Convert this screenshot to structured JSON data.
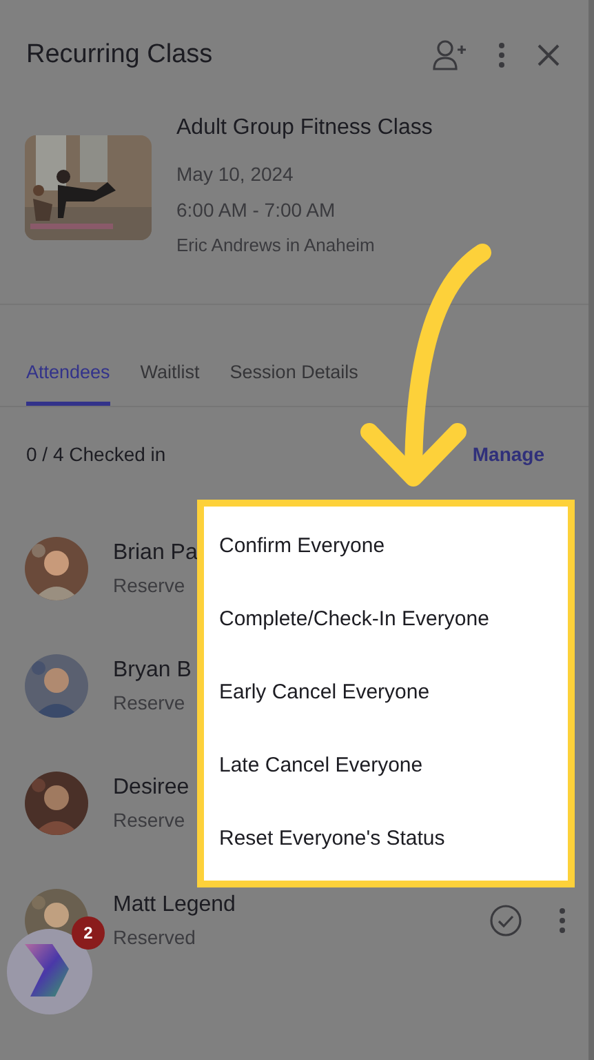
{
  "header": {
    "title": "Recurring Class"
  },
  "class_info": {
    "name": "Adult Group Fitness Class",
    "date": "May 10, 2024",
    "time": "6:00 AM - 7:00 AM",
    "instructor": "Eric Andrews in Anaheim"
  },
  "tabs": [
    {
      "label": "Attendees",
      "selected": true
    },
    {
      "label": "Waitlist",
      "selected": false
    },
    {
      "label": "Session Details",
      "selected": false
    }
  ],
  "check_in": {
    "summary": "0 / 4 Checked in",
    "action": "Manage"
  },
  "attendees": [
    {
      "name": "Brian Pa",
      "status": "Reserve"
    },
    {
      "name": "Bryan B",
      "status": "Reserve"
    },
    {
      "name": "Desiree",
      "status": "Reserve"
    },
    {
      "name": "Matt Legend",
      "status": "Reserved",
      "actions": true
    }
  ],
  "manage_menu": {
    "items": [
      "Confirm Everyone",
      "Complete/Check-In Everyone",
      "Early Cancel Everyone",
      "Late Cancel Everyone",
      "Reset Everyone's Status"
    ]
  },
  "chat_bubble": {
    "badge": "2"
  }
}
